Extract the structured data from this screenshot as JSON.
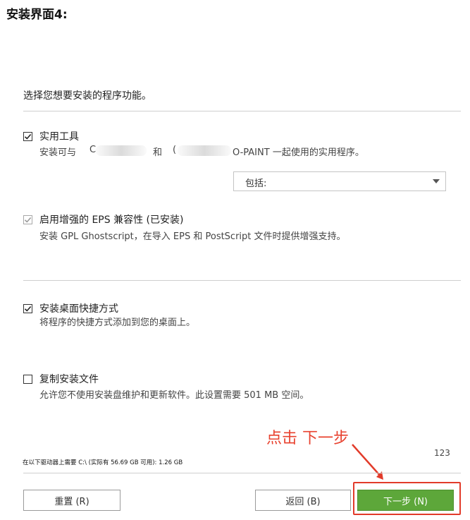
{
  "heading": "安装界面4:",
  "intro": "选择您想要安装的程序功能。",
  "options": {
    "utilities": {
      "title": "实用工具",
      "desc_prefix": "安装可与",
      "desc_c1": "C",
      "desc_mid": "和",
      "desc_c2": "(",
      "desc_suffix": "O-PAINT 一起使用的实用程序。",
      "checked": true
    },
    "include_select": {
      "label": "包括:"
    },
    "eps": {
      "title": "启用增强的 EPS 兼容性 (已安装)",
      "desc": "安装 GPL Ghostscript，在导入 EPS 和 PostScript 文件时提供增强支持。",
      "checked": true,
      "disabled": true
    },
    "shortcut": {
      "title": "安装桌面快捷方式",
      "desc": "将程序的快捷方式添加到您的桌面上。",
      "checked": true
    },
    "copy_files": {
      "title": "复制安装文件",
      "desc": "允许您不使用安装盘维护和更新软件。此设置需要 501 MB 空间。",
      "checked": false
    }
  },
  "space_info": "在以下驱动器上需要 C:\\ (实际有 56.69 GB 可用): 1.26 GB",
  "page_indicator": "123",
  "annotation": "点击 下一步",
  "buttons": {
    "reset": "重置 (R)",
    "back": "返回 (B)",
    "next": "下一步 (N)"
  },
  "colors": {
    "accent_green": "#5da73a",
    "annotation_red": "#e8412e"
  }
}
